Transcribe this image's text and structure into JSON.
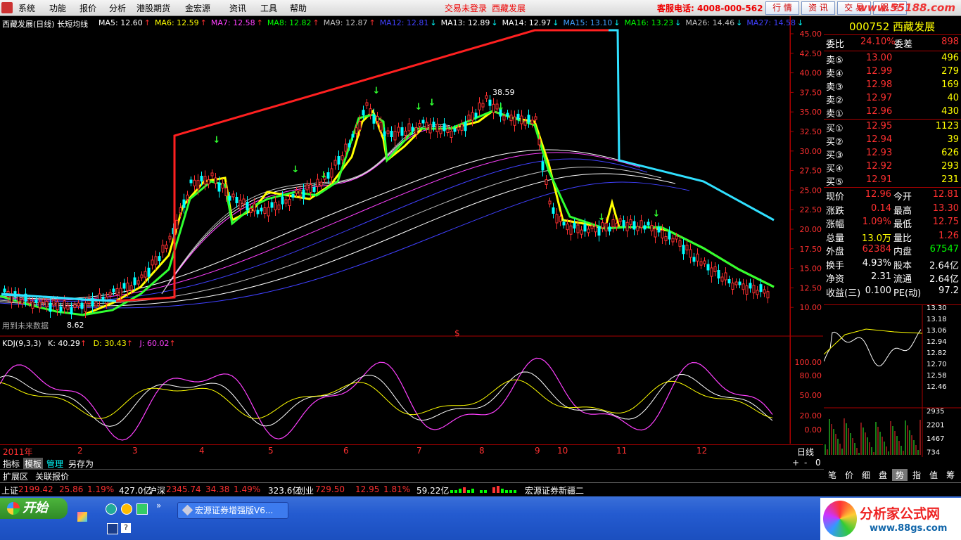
{
  "menu": [
    "系统",
    "功能",
    "报价",
    "分析",
    "港股期货",
    "金宏源",
    "资讯",
    "工具",
    "帮助"
  ],
  "status": {
    "login": "交易未登录",
    "stock": "西藏发展",
    "service": "客服电话: 4008-000-562"
  },
  "top_buttons": [
    "行 情",
    "资 讯",
    "交 易",
    "服 务"
  ],
  "watermark": "www.55188.com",
  "chart": {
    "title": "西藏发展(日线) 长短均线",
    "ma": [
      {
        "label": "MA5: 12.60",
        "color": "#ffffff",
        "arrow": "↑",
        "arrow_color": "#ff3030"
      },
      {
        "label": "MA6: 12.59",
        "color": "#ffff00",
        "arrow": "↑",
        "arrow_color": "#ff3030"
      },
      {
        "label": "MA7: 12.58",
        "color": "#ff40ff",
        "arrow": "↑",
        "arrow_color": "#ff3030"
      },
      {
        "label": "MA8: 12.82",
        "color": "#00ff00",
        "arrow": "↑",
        "arrow_color": "#ff3030"
      },
      {
        "label": "MA9: 12.87",
        "color": "#c0c0c0",
        "arrow": "↑",
        "arrow_color": "#ff3030"
      },
      {
        "label": "MA12: 12.81",
        "color": "#4040ff",
        "arrow": "↓",
        "arrow_color": "#00ffff"
      },
      {
        "label": "MA13: 12.89",
        "color": "#ffffff",
        "arrow": "↓",
        "arrow_color": "#00ffff"
      },
      {
        "label": "MA14: 12.97",
        "color": "#ffffff",
        "arrow": "↓",
        "arrow_color": "#00ffff"
      },
      {
        "label": "MA15: 13.10",
        "color": "#40a0ff",
        "arrow": "↓",
        "arrow_color": "#00ffff"
      },
      {
        "label": "MA16: 13.23",
        "color": "#00ff00",
        "arrow": "↓",
        "arrow_color": "#00ffff"
      },
      {
        "label": "MA26: 14.46",
        "color": "#c0c0c0",
        "arrow": "↓",
        "arrow_color": "#00ffff"
      },
      {
        "label": "MA27: 14.58",
        "color": "#4040ff",
        "arrow": "↓",
        "arrow_color": "#00ffff"
      }
    ],
    "y_ticks": [
      "45.00",
      "42.50",
      "40.00",
      "37.50",
      "35.00",
      "32.50",
      "30.00",
      "27.50",
      "25.00",
      "22.50",
      "20.00",
      "17.50",
      "15.00",
      "12.50",
      "10.00"
    ],
    "high_label": "38.59",
    "low_label": "8.62",
    "future_note": "用到未来数据",
    "dollar_mark": "$"
  },
  "kdj": {
    "name": "KDJ(9,3,3)",
    "k": "K: 40.29",
    "d": "D: 30.43",
    "j": "J: 60.02",
    "y_ticks": [
      "100.00",
      "80.00",
      "50.00",
      "20.00",
      "0.00"
    ]
  },
  "x_axis": {
    "year": "2011年",
    "months": [
      "2",
      "3",
      "4",
      "5",
      "6",
      "7",
      "8",
      "9",
      "10",
      "11",
      "12"
    ],
    "period": "日线"
  },
  "quote": {
    "code_name": "000752 西藏发展",
    "weibi_label": "委比",
    "weibi": "24.10%",
    "weicha_label": "委差",
    "weicha": "898",
    "sell": [
      {
        "label": "卖⑤",
        "price": "13.00",
        "vol": "496"
      },
      {
        "label": "卖④",
        "price": "12.99",
        "vol": "279"
      },
      {
        "label": "卖③",
        "price": "12.98",
        "vol": "169"
      },
      {
        "label": "卖②",
        "price": "12.97",
        "vol": "40"
      },
      {
        "label": "卖①",
        "price": "12.96",
        "vol": "430"
      }
    ],
    "buy": [
      {
        "label": "买①",
        "price": "12.95",
        "vol": "1123"
      },
      {
        "label": "买②",
        "price": "12.94",
        "vol": "39"
      },
      {
        "label": "买③",
        "price": "12.93",
        "vol": "626"
      },
      {
        "label": "买④",
        "price": "12.92",
        "vol": "293"
      },
      {
        "label": "买⑤",
        "price": "12.91",
        "vol": "231"
      }
    ],
    "stats": [
      {
        "l1": "现价",
        "v1": "12.96",
        "l2": "今开",
        "v2": "12.81",
        "c1": "#ff3030",
        "c2": "#ff3030"
      },
      {
        "l1": "涨跌",
        "v1": "0.14",
        "l2": "最高",
        "v2": "13.30",
        "c1": "#ff3030",
        "c2": "#ff3030"
      },
      {
        "l1": "涨幅",
        "v1": "1.09%",
        "l2": "最低",
        "v2": "12.75",
        "c1": "#ff3030",
        "c2": "#ff3030"
      },
      {
        "l1": "总量",
        "v1": "13.0万",
        "l2": "量比",
        "v2": "1.26",
        "c1": "#ffff00",
        "c2": "#ff3030"
      },
      {
        "l1": "外盘",
        "v1": "62384",
        "l2": "内盘",
        "v2": "67547",
        "c1": "#ff3030",
        "c2": "#00ff00"
      },
      {
        "l1": "换手",
        "v1": "4.93%",
        "l2": "股本",
        "v2": "2.64亿",
        "c1": "#ffffff",
        "c2": "#ffffff"
      },
      {
        "l1": "净资",
        "v1": "2.31",
        "l2": "流通",
        "v2": "2.64亿",
        "c1": "#ffffff",
        "c2": "#ffffff"
      },
      {
        "l1": "收益(三)",
        "v1": "0.100",
        "l2": "PE(动)",
        "v2": "97.2",
        "c1": "#ffffff",
        "c2": "#ffffff"
      }
    ]
  },
  "mini": {
    "price_ticks": [
      "13.30",
      "13.18",
      "13.06",
      "12.94",
      "12.82",
      "12.70",
      "12.58",
      "12.46"
    ],
    "vol_ticks": [
      "2935",
      "2201",
      "1467",
      "734"
    ]
  },
  "bottom_tabs": [
    "指标",
    "模板",
    "管理",
    "另存为"
  ],
  "ext_tabs": [
    "扩展区",
    "关联报价"
  ],
  "zoom": [
    "+",
    "-",
    "0"
  ],
  "right_tabs": [
    "笔",
    "价",
    "细",
    "盘",
    "势",
    "指",
    "值",
    "筹"
  ],
  "indices": {
    "sh_label": "上证",
    "sh_val": "2199.42",
    "sh_chg": "25.86",
    "sh_pct": "1.19%",
    "sh_amt": "427.0亿",
    "hs_label": "沪深",
    "hs_val": "2345.74",
    "hs_chg": "34.38",
    "hs_pct": "1.49%",
    "hs_amt": "323.6亿",
    "cy_label": "创业",
    "cy_val": "729.50",
    "cy_chg": "12.95",
    "cy_pct": "1.81%",
    "cy_amt": "59.22亿",
    "broker": "宏源证券新疆二"
  },
  "taskbar": {
    "start": "开始",
    "task": "宏源证券增强版V6..."
  },
  "site": {
    "name": "分析家公式网",
    "url": "www.88gs.com"
  }
}
